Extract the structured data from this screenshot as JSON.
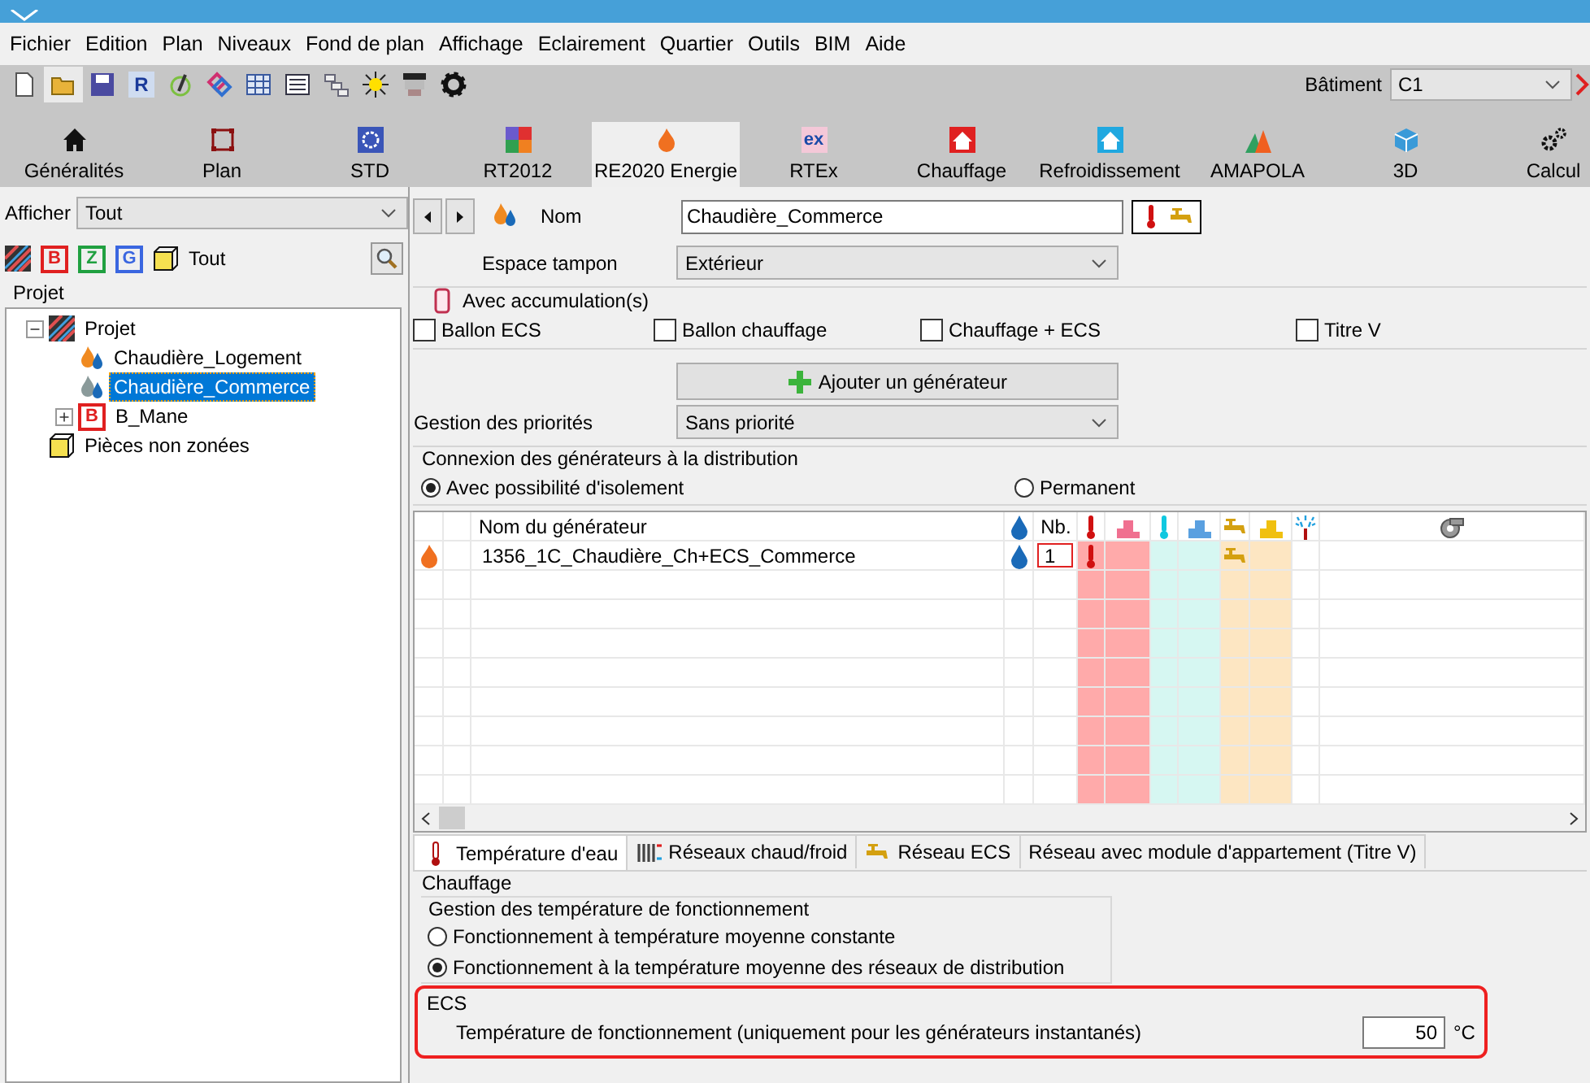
{
  "menu": [
    "Fichier",
    "Edition",
    "Plan",
    "Niveaux",
    "Fond de plan",
    "Affichage",
    "Eclairement",
    "Quartier",
    "Outils",
    "BIM",
    "Aide"
  ],
  "toolbar": [
    {
      "kind": "new",
      "selected": false
    },
    {
      "kind": "open",
      "selected": true
    },
    {
      "kind": "save",
      "selected": false
    },
    {
      "kind": "letter",
      "text": "R",
      "selected": false
    },
    {
      "kind": "pen",
      "selected": false
    },
    {
      "kind": "knot",
      "selected": false
    },
    {
      "kind": "table",
      "selected": false
    },
    {
      "kind": "list",
      "selected": false
    },
    {
      "kind": "chain",
      "selected": false
    },
    {
      "kind": "sun",
      "selected": false
    },
    {
      "kind": "monitor",
      "selected": false
    },
    {
      "kind": "gear",
      "selected": false
    }
  ],
  "building": {
    "label": "Bâtiment",
    "value": "C1"
  },
  "modules": [
    {
      "label": "Généralités",
      "kind": "home",
      "selected": false
    },
    {
      "label": "Plan",
      "kind": "plan",
      "selected": false
    },
    {
      "label": "STD",
      "kind": "std",
      "selected": false
    },
    {
      "label": "RT2012",
      "kind": "tiles",
      "selected": false
    },
    {
      "label": "RE2020 Energie",
      "kind": "flame",
      "selected": true
    },
    {
      "label": "RTEx",
      "kind": "glyph",
      "glyph": "ex",
      "selected": false
    },
    {
      "label": "Chauffage",
      "kind": "red-house",
      "selected": false
    },
    {
      "label": "Refroidissement",
      "kind": "blue-house",
      "selected": false
    },
    {
      "label": "AMAPOLA",
      "kind": "mountain",
      "selected": false
    },
    {
      "label": "3D",
      "kind": "cube",
      "selected": false
    },
    {
      "label": "Calcul",
      "kind": "gears",
      "selected": false
    }
  ],
  "left": {
    "filter_label": "Afficher",
    "filter_value": "Tout",
    "filters": [
      {
        "kind": "stripes"
      },
      {
        "kind": "letter",
        "text": "B",
        "color": "#e02020"
      },
      {
        "kind": "letter",
        "text": "Z",
        "color": "#20a040"
      },
      {
        "kind": "letter",
        "text": "G",
        "color": "#3a66e0"
      },
      {
        "kind": "block",
        "text": "Tout"
      }
    ],
    "group": "Projet",
    "tree": [
      {
        "label": "Projet",
        "kind": "stripes",
        "selected": false,
        "expanded": true,
        "children": [
          {
            "label": "Chaudière_Logement",
            "kind": "boiler",
            "selected": false
          },
          {
            "label": "Chaudière_Commerce",
            "kind": "boiler-grey",
            "selected": true
          },
          {
            "label": "B_Mane",
            "kind": "glyph",
            "glyph": "B",
            "selected": false,
            "expanded": false
          }
        ]
      },
      {
        "label": "Pièces non zonées",
        "kind": "block",
        "selected": false
      }
    ]
  },
  "form": {
    "nom_label": "Nom",
    "nom_value": "Chaudière_Commerce",
    "espace_label": "Espace tampon",
    "espace_value": "Extérieur",
    "accumulation": {
      "title": "Avec accumulation(s)",
      "options": [
        {
          "label": "Ballon ECS",
          "checked": false
        },
        {
          "label": "Ballon chauffage",
          "checked": false
        },
        {
          "label": "Chauffage + ECS",
          "checked": false
        },
        {
          "label": "Titre V",
          "checked": false
        }
      ]
    },
    "add_button": "Ajouter un générateur",
    "priority_label": "Gestion des priorités",
    "priority_value": "Sans priorité",
    "connexion": {
      "title": "Connexion des générateurs à la distribution",
      "options": [
        {
          "label": "Avec possibilité d'isolement",
          "selected": true
        },
        {
          "label": "Permanent",
          "selected": false
        }
      ]
    }
  },
  "generators": {
    "columns": [
      {
        "kind": "icon"
      },
      {
        "kind": "blank"
      },
      {
        "kind": "name",
        "label": "Nom du générateur"
      },
      {
        "kind": "drop"
      },
      {
        "kind": "count",
        "label": "Nb."
      },
      {
        "kind": "heat-temp"
      },
      {
        "kind": "heat-rank"
      },
      {
        "kind": "cool-temp"
      },
      {
        "kind": "cool-rank"
      },
      {
        "kind": "dhw-tap"
      },
      {
        "kind": "dhw-rank"
      },
      {
        "kind": "shower"
      },
      {
        "kind": "fan"
      }
    ],
    "rows": [
      {
        "name": "1356_1C_Chaudière_Ch+ECS_Commerce",
        "count": "1",
        "heating": true,
        "dhw": true
      }
    ]
  },
  "bottom_tabs": [
    {
      "label": "Température d'eau",
      "kind": "thermo",
      "selected": true
    },
    {
      "label": "Réseaux chaud/froid",
      "kind": "radiator",
      "selected": false
    },
    {
      "label": "Réseau ECS",
      "kind": "tap",
      "selected": false
    },
    {
      "label": "Réseau avec module d'appartement (Titre V)",
      "kind": "none",
      "selected": false
    }
  ],
  "water_temp": {
    "heating_title": "Chauffage",
    "mode_title": "Gestion des température de fonctionnement",
    "modes": [
      {
        "label": "Fonctionnement à température moyenne constante",
        "selected": false
      },
      {
        "label": "Fonctionnement à la température moyenne des réseaux de distribution",
        "selected": true
      }
    ],
    "dhw_title": "ECS",
    "dhw_label": "Température de fonctionnement (uniquement pour les générateurs instantanés)",
    "dhw_value": "50",
    "dhw_unit": "°C",
    "dhw_highlighted": true
  }
}
